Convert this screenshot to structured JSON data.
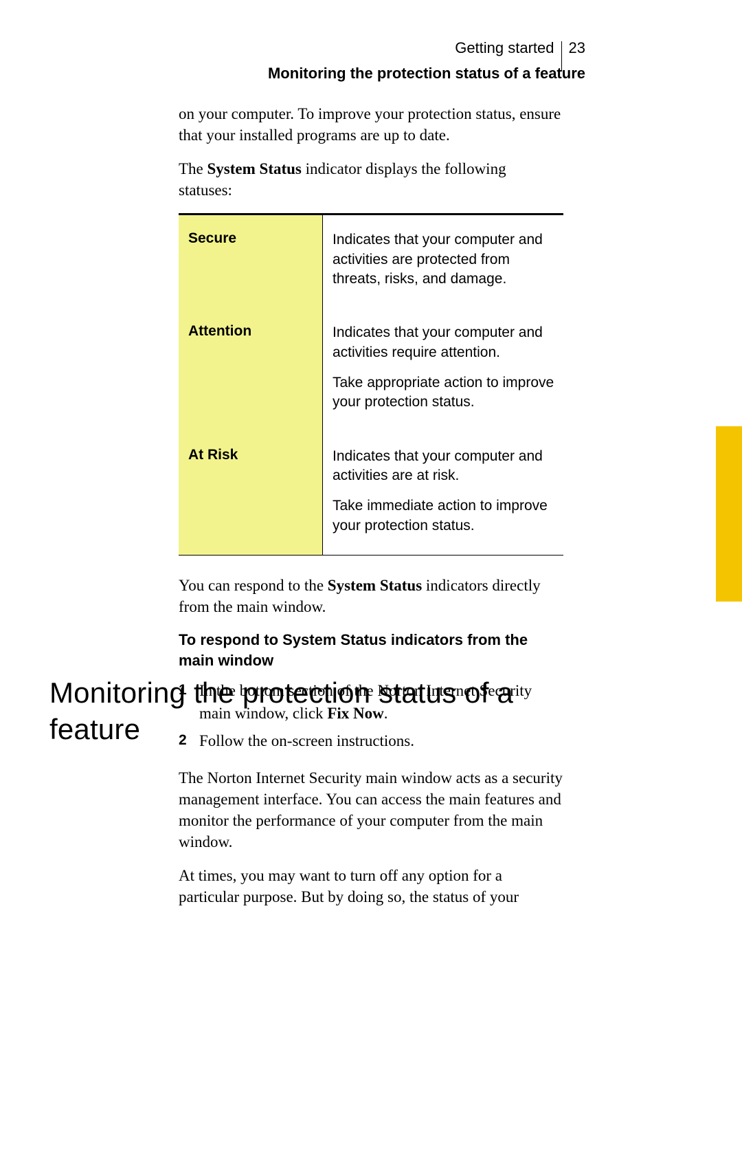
{
  "header": {
    "chapter": "Getting started",
    "page_number": "23",
    "section": "Monitoring the protection status of a feature"
  },
  "intro": {
    "p1": "on your computer. To improve your protection status, ensure that your installed programs are up to date.",
    "p2_pre": "The ",
    "p2_bold": "System Status",
    "p2_post": " indicator displays the following statuses:"
  },
  "status_table": [
    {
      "label": "Secure",
      "paras": [
        "Indicates that your computer and activities are protected from threats, risks, and damage."
      ]
    },
    {
      "label": "Attention",
      "paras": [
        "Indicates that your computer and activities require attention.",
        "Take appropriate action to improve your protection status."
      ]
    },
    {
      "label": "At Risk",
      "paras": [
        "Indicates that your computer and activities are at risk.",
        "Take immediate action to improve your protection status."
      ]
    }
  ],
  "after_table": {
    "p_pre": "You can respond to the ",
    "p_bold": "System Status",
    "p_post": " indicators directly from the main window."
  },
  "procedure": {
    "title": "To respond to System Status indicators from the main window",
    "steps": [
      {
        "num": "1",
        "pre": "In the bottom section of the Norton Internet Security main window, click ",
        "bold": "Fix Now",
        "post": "."
      },
      {
        "num": "2",
        "pre": "Follow the on-screen instructions.",
        "bold": "",
        "post": ""
      }
    ]
  },
  "heading2": "Monitoring the protection status of a feature",
  "body2": {
    "p1": "The Norton Internet Security main window acts as a security management interface. You can access the main features and monitor the performance of your computer from the main window.",
    "p2": "At times, you may want to turn off any option for a particular purpose. But by doing so, the status of your"
  }
}
